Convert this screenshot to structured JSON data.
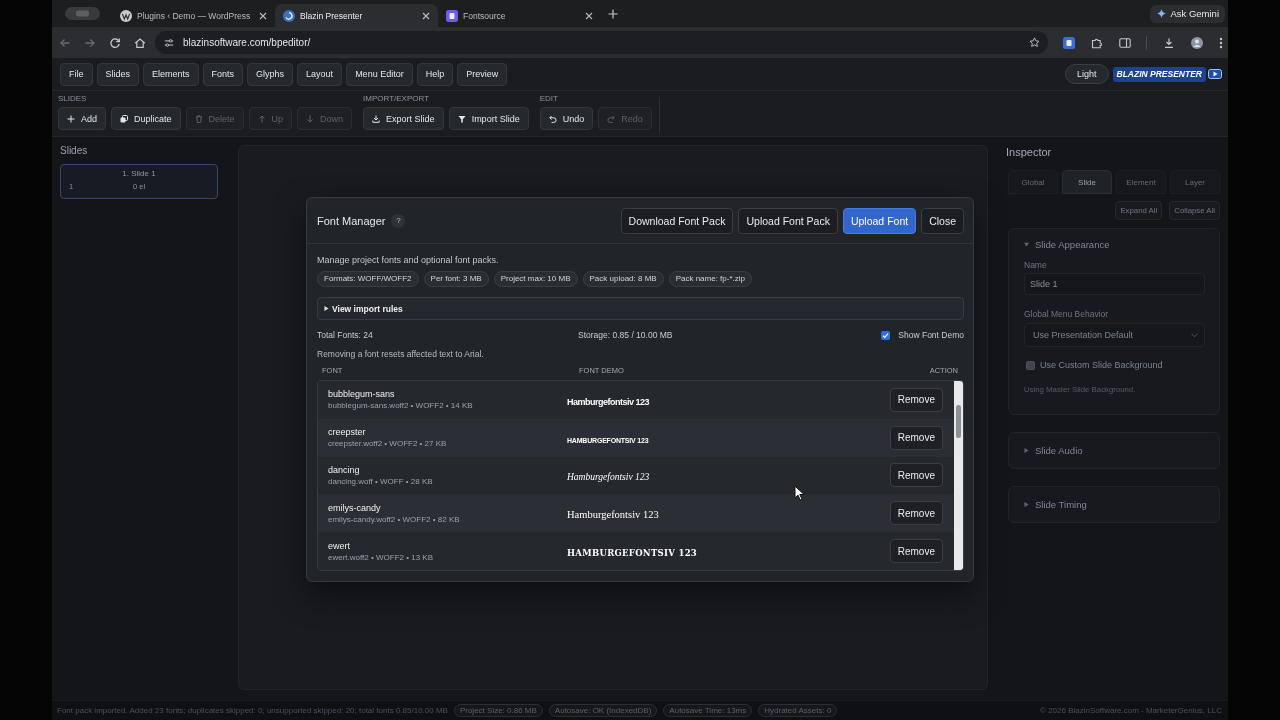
{
  "browser": {
    "tabs": [
      {
        "title": "Plugins ‹ Demo — WordPress",
        "selected": false
      },
      {
        "title": "Blazin Presenter",
        "selected": true
      },
      {
        "title": "Fontsource",
        "selected": false
      }
    ],
    "assistant_button": "Ask Gemini",
    "address": "blazinsoftware.com/bpeditor/"
  },
  "menu_bar": {
    "items": [
      "File",
      "Slides",
      "Elements",
      "Fonts",
      "Glyphs",
      "Layout",
      "Menu Editor",
      "Help",
      "Preview"
    ],
    "theme_button": "Light",
    "logo": "BLAZIN PRESENTER"
  },
  "toolbar": {
    "groups": [
      {
        "title": "SLIDES",
        "buttons": [
          {
            "label": "Add",
            "disabled": false
          },
          {
            "label": "Duplicate",
            "disabled": false
          },
          {
            "label": "Delete",
            "disabled": true
          },
          {
            "label": "Up",
            "disabled": true
          },
          {
            "label": "Down",
            "disabled": true
          }
        ]
      },
      {
        "title": "IMPORT/EXPORT",
        "buttons": [
          {
            "label": "Export Slide",
            "disabled": false
          },
          {
            "label": "Import Slide",
            "disabled": false
          }
        ]
      },
      {
        "title": "EDIT",
        "buttons": [
          {
            "label": "Undo",
            "disabled": false
          },
          {
            "label": "Redo",
            "disabled": true
          }
        ]
      }
    ]
  },
  "slides_panel": {
    "title": "Slides",
    "slides": [
      {
        "label": "1. Slide 1",
        "number": "1",
        "meta": "0 el",
        "selected": true
      }
    ]
  },
  "inspector": {
    "title": "Inspector",
    "tabs": [
      {
        "label": "Global",
        "selected": false
      },
      {
        "label": "Slide",
        "selected": true
      },
      {
        "label": "Element",
        "selected": false
      },
      {
        "label": "Layer",
        "selected": false
      }
    ],
    "actions": [
      "Expand All",
      "Collapse All"
    ],
    "sections": [
      {
        "title": "Slide Appearance",
        "expanded": true,
        "name_label": "Name",
        "name_value": "Slide 1",
        "menu_label": "Global Menu Behavior",
        "menu_value": "Use Presentation Default",
        "custom_background": {
          "label": "Use Custom Slide Background",
          "checked": false
        },
        "hint": "Using Master Slide Background."
      },
      {
        "title": "Slide Audio",
        "expanded": false
      },
      {
        "title": "Slide Timing",
        "expanded": false
      }
    ]
  },
  "font_manager": {
    "title": "Font Manager",
    "help": "?",
    "buttons": [
      {
        "label": "Download Font Pack",
        "kind": "secondary"
      },
      {
        "label": "Upload Font Pack",
        "kind": "secondary"
      },
      {
        "label": "Upload Font",
        "kind": "primary"
      },
      {
        "label": "Close",
        "kind": "secondary"
      }
    ],
    "description": "Manage project fonts and optional font packs.",
    "limits": [
      "Formats: WOFF/WOFF2",
      "Per font: 3 MB",
      "Project max: 10 MB",
      "Pack upload: 8 MB",
      "Pack name: fp-*.zip"
    ],
    "import_rules": {
      "label": "View import rules",
      "expanded": false
    },
    "total": "Total Fonts: 24",
    "storage": "Storage: 0.85 / 10.00 MB",
    "show_demo": {
      "label": "Show Font Demo",
      "checked": true
    },
    "note": "Removing a font resets affected text to Arial.",
    "columns": [
      "FONT",
      "FONT DEMO",
      "ACTION"
    ],
    "fonts": [
      {
        "name": "bubblegum-sans",
        "file": "bubblegum-sans.woff2 • WOFF2 • 14 KB",
        "demo": "Hamburgefontsiv 123",
        "action": "Remove"
      },
      {
        "name": "creepster",
        "file": "creepster.woff2 • WOFF2 • 27 KB",
        "demo": "HAMBURGEFONTSIV 123",
        "action": "Remove"
      },
      {
        "name": "dancing",
        "file": "dancing.woff • WOFF • 28 KB",
        "demo": "Hamburgefontsiv 123",
        "action": "Remove"
      },
      {
        "name": "emilys-candy",
        "file": "emilys-candy.woff2 • WOFF2 • 82 KB",
        "demo": "Hamburgefontsiv 123",
        "action": "Remove"
      },
      {
        "name": "ewert",
        "file": "ewert.woff2 • WOFF2 • 13 KB",
        "demo": "HAMBURGEFONTSIV 123",
        "action": "Remove"
      }
    ]
  },
  "status_bar": {
    "message": "Font pack imported. Added 23 fonts; duplicates skipped: 0; unsupported skipped: 20; total fonts 0.85/10.00 MB",
    "stats": [
      "Project Size: 0.86 MB",
      "Autosave: OK (IndexedDB)",
      "Autosave Time: 13ms",
      "Hydrated Assets: 0"
    ],
    "copyright": "© 2026 BlazinSoftware.com - MarketerGenius, LLC"
  }
}
